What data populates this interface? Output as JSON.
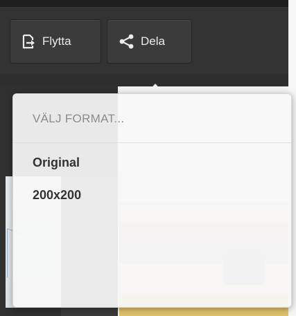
{
  "toolbar": {
    "move": {
      "label": "Flytta",
      "icon": "move-out-icon"
    },
    "share": {
      "label": "Dela",
      "icon": "share-icon"
    }
  },
  "popover": {
    "header": "VÄLJ FORMAT...",
    "options": [
      {
        "label": "Original"
      },
      {
        "label": "200x200"
      }
    ]
  },
  "colors": {
    "toolbar_bg": "#333333",
    "button_bg": "#3b3b3b",
    "button_text": "#ececec",
    "popover_bg": "#f7f7f7",
    "header_text": "#8b8b8b",
    "option_text": "#333333"
  }
}
